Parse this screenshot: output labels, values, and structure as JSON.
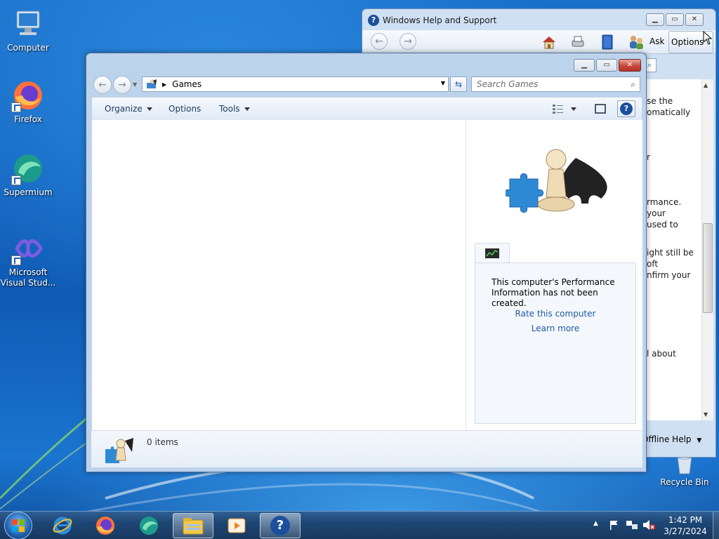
{
  "desktop": {
    "icons": [
      {
        "label": "Computer",
        "icon": "computer-icon"
      },
      {
        "label": "Firefox",
        "icon": "firefox-icon"
      },
      {
        "label": "Supermium",
        "icon": "supermium-icon"
      },
      {
        "label": "Microsoft Visual Stud...",
        "icon": "visual-studio-icon"
      },
      {
        "label": "Recycle Bin",
        "icon": "recycle-bin-icon"
      }
    ]
  },
  "help_window": {
    "title": "Windows Help and Support",
    "toolbar": {
      "ask_label": "Ask",
      "options_label": "Options"
    },
    "content_lines": [
      "se the",
      "omatically",
      "r",
      "rmance.",
      "your",
      "used to",
      "ight still be",
      "oft",
      "nfirm your",
      "l about"
    ],
    "bottom_label": "Offline Help"
  },
  "games_window": {
    "address": "Games",
    "search_placeholder": "Search Games",
    "commands": {
      "organize": "Organize",
      "options": "Options",
      "tools": "Tools"
    },
    "performance": {
      "message": "This computer's Performance Information has not been created.",
      "rate_link": "Rate this computer",
      "learn_link": "Learn more"
    },
    "status": "0 items"
  },
  "taskbar": {
    "items": [
      "start-orb",
      "internet-explorer-icon",
      "firefox-icon",
      "supermium-icon",
      "windows-explorer-icon",
      "media-player-icon",
      "help-icon"
    ],
    "time": "1:42 PM",
    "date": "3/27/2024"
  }
}
